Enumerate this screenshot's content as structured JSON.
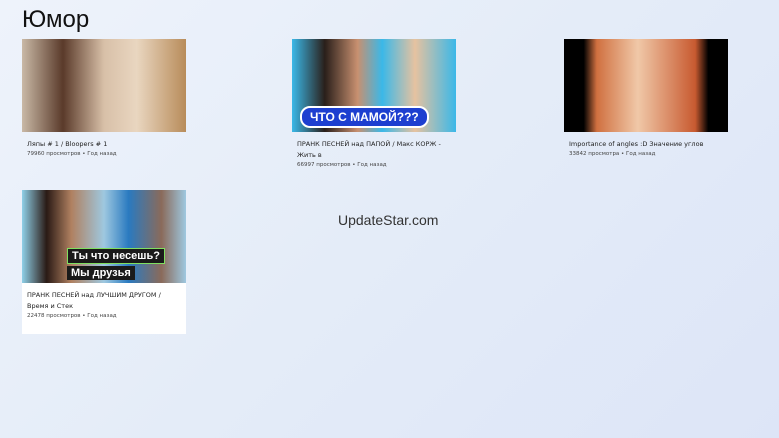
{
  "page": {
    "title": "Юмор",
    "watermark": "UpdateStar.com"
  },
  "videos": [
    {
      "title": "Ляпы # 1 / Bloopers # 1",
      "views": "79960 просмотров • Год назад"
    },
    {
      "title": "ПРАНК ПЕСНЕЙ над ПАПОЙ / Макс КОРЖ - Жить в",
      "views": "66997 просмотров • Год назад",
      "overlay": "ЧТО С МАМОЙ???"
    },
    {
      "title": "Importance of angles :D Значение углов",
      "views": "33842 просмотра • Год назад"
    },
    {
      "title": "ПРАНК ПЕСНЕЙ над ЛУЧШИМ ДРУГОМ / Время и Стек",
      "views": "22478 просмотров • Год назад",
      "overlay": "Ты что несешь?",
      "overlay2": "Мы друзья"
    }
  ]
}
